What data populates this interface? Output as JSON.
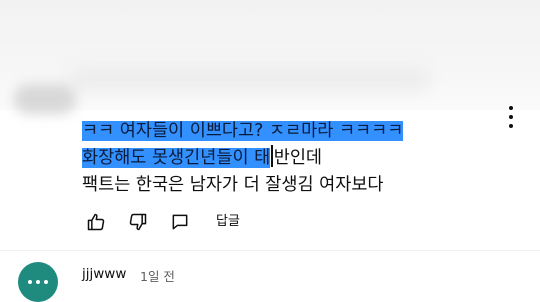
{
  "comment": {
    "line1_selected": "ㅋㅋ 여자들이 이쁘다고? ㅈㄹ마라 ㅋㅋㅋㅋ",
    "line2_selected": "화장해도 못생긴년들이 태",
    "line2_rest": "반인데",
    "line3": "팩트는 한국은 남자가 더 잘생김 여자보다"
  },
  "actions": {
    "reply_label": "답글"
  },
  "next_comment": {
    "author": "jjjwww",
    "time": "1일 전"
  },
  "colors": {
    "selection": "#3390ff",
    "text": "#0f0f0f",
    "muted": "#606060",
    "avatar": "#1e8b7e"
  },
  "icons": [
    "more-vert-icon",
    "thumb-up-icon",
    "thumb-down-icon",
    "comment-icon"
  ]
}
